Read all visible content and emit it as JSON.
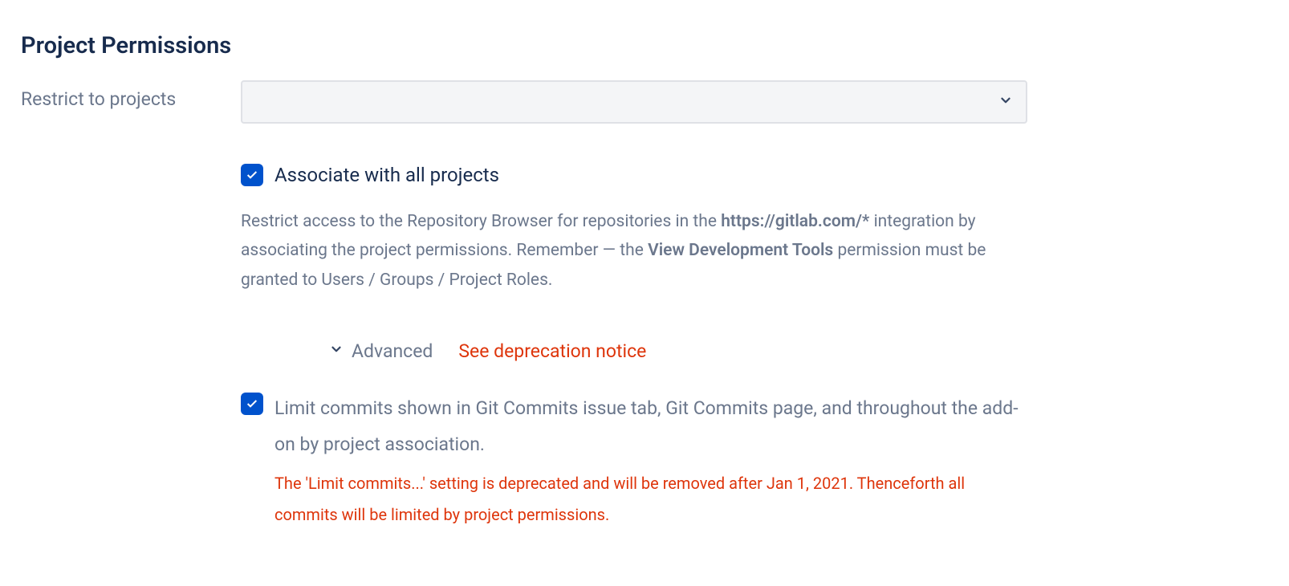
{
  "section": {
    "title": "Project Permissions"
  },
  "restrict": {
    "label": "Restrict to projects",
    "selected": ""
  },
  "associate": {
    "label": "Associate with all projects",
    "checked": true,
    "help_pre": "Restrict access to the Repository Browser for repositories in the ",
    "help_bold1": "https://gitlab.com/*",
    "help_mid": " integration by associating the project permissions. Remember — the ",
    "help_bold2": "View Development Tools",
    "help_post": " permission must be granted to Users / Groups / Project Roles."
  },
  "advanced": {
    "label": "Advanced",
    "notice_link": "See deprecation notice"
  },
  "limit": {
    "label": "Limit commits shown in Git Commits issue tab, Git Commits page, and throughout the add-on by project association.",
    "checked": true,
    "deprecation": "The 'Limit commits...' setting is deprecated and will be removed after Jan 1, 2021. Thenceforth all commits will be limited by project permissions."
  }
}
